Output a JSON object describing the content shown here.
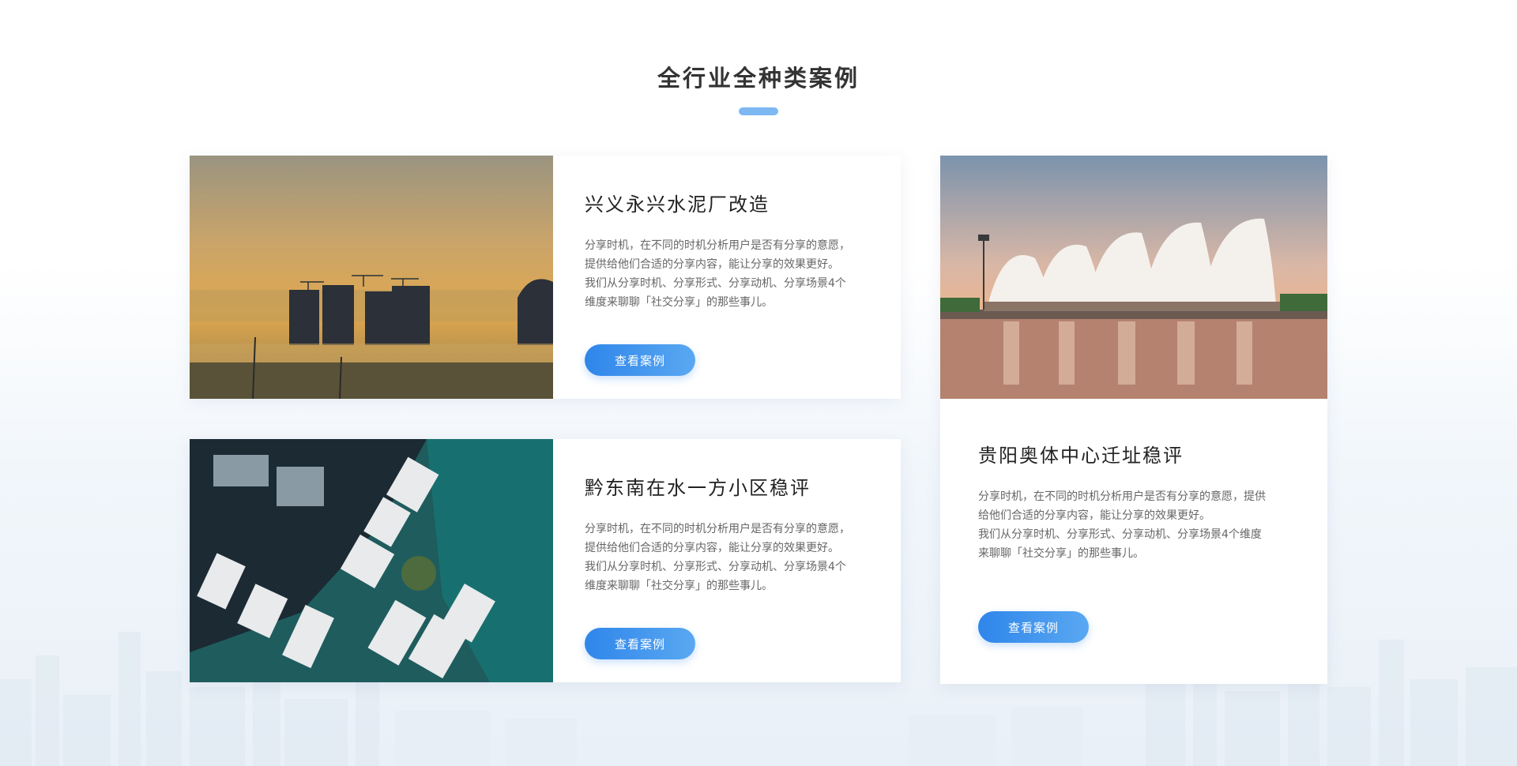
{
  "section": {
    "title": "全行业全种类案例",
    "accent_color": "#7db8f3"
  },
  "cases": [
    {
      "title": "兴义永兴水泥厂改造",
      "desc_line1": "分享时机，在不同的时机分析用户是否有分享的意愿，",
      "desc_line2": "提供给他们合适的分享内容，能让分享的效果更好。",
      "desc_line3": "我们从分享时机、分享形式、分享动机、分享场景4个",
      "desc_line4": "维度来聊聊「社交分享」的那些事儿。",
      "button_label": "查看案例",
      "image": "foggy-city-sunrise"
    },
    {
      "title": "黔东南在水一方小区稳评",
      "desc_line1": "分享时机，在不同的时机分析用户是否有分享的意愿，",
      "desc_line2": "提供给他们合适的分享内容，能让分享的效果更好。",
      "desc_line3": "我们从分享时机、分享形式、分享动机、分享场景4个",
      "desc_line4": "维度来聊聊「社交分享」的那些事儿。",
      "button_label": "查看案例",
      "image": "aerial-residential-towers"
    },
    {
      "title": "贵阳奥体中心迁址稳评",
      "desc_line1": "分享时机，在不同的时机分析用户是否有分享的意愿，提供",
      "desc_line2": "给他们合适的分享内容，能让分享的效果更好。",
      "desc_line3": "我们从分享时机、分享形式、分享动机、分享场景4个维度",
      "desc_line4": "来聊聊「社交分享」的那些事儿。",
      "button_label": "查看案例",
      "image": "stadium-at-sunset"
    }
  ],
  "colors": {
    "button_start": "#2f86ea",
    "button_end": "#5aa8f2",
    "title_text": "#333333",
    "body_text": "#666666"
  }
}
